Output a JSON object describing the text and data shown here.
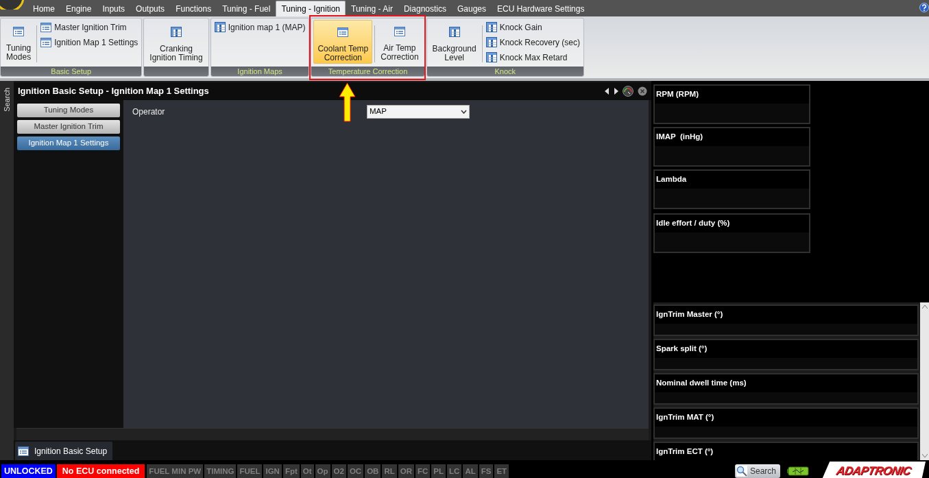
{
  "top_tabs": [
    {
      "label": "Home",
      "selected": false
    },
    {
      "label": "Engine",
      "selected": false
    },
    {
      "label": "Inputs",
      "selected": false
    },
    {
      "label": "Outputs",
      "selected": false
    },
    {
      "label": "Functions",
      "selected": false
    },
    {
      "label": "Tuning - Fuel",
      "selected": false
    },
    {
      "label": "Tuning - Ignition",
      "selected": true
    },
    {
      "label": "Tuning - Air",
      "selected": false
    },
    {
      "label": "Diagnostics",
      "selected": false
    },
    {
      "label": "Gauges",
      "selected": false
    },
    {
      "label": "ECU Hardware Settings",
      "selected": false
    }
  ],
  "ribbon_groups": [
    {
      "title": "Basic Setup",
      "highlighted": false,
      "items": [
        {
          "label": "Tuning\nModes",
          "kind": "large_page",
          "selected": false
        },
        {
          "label": "Master Ignition Trim",
          "kind": "small_page",
          "selected": false
        },
        {
          "label": "Ignition Map 1 Settings",
          "kind": "small_page",
          "selected": false
        }
      ]
    },
    {
      "highlighted": false,
      "items": [
        {
          "label": "Cranking\nIgnition Timing",
          "kind": "large_table",
          "selected": false
        }
      ]
    },
    {
      "title": "Ignition Maps",
      "highlighted": false,
      "items": [
        {
          "label": "Ignition map 1 (MAP)",
          "kind": "small_table",
          "selected": false
        }
      ]
    },
    {
      "title": "Temperature Correction",
      "highlighted": true,
      "items": [
        {
          "label": "Coolant Temp\nCorrection",
          "kind": "large_page",
          "selected": true
        },
        {
          "label": "Air Temp\nCorrection",
          "kind": "large_page",
          "selected": false
        }
      ]
    },
    {
      "title": "Knock",
      "highlighted": false,
      "items": [
        {
          "label": "Background\nLevel",
          "kind": "large_table",
          "selected": false
        },
        {
          "label": "Knock Gain",
          "kind": "small_table",
          "selected": false
        },
        {
          "label": "Knock Recovery (sec)",
          "kind": "small_table",
          "selected": false
        },
        {
          "label": "Knock Max Retard",
          "kind": "small_table",
          "selected": false
        }
      ]
    }
  ],
  "side_tab": "Search",
  "panel": {
    "title": "Ignition Basic Setup - Ignition Map 1 Settings",
    "nav": [
      {
        "label": "Tuning Modes",
        "selected": false
      },
      {
        "label": "Master Ignition Trim",
        "selected": false
      },
      {
        "label": "Ignition Map 1 Settings",
        "selected": true
      }
    ],
    "fields": [
      {
        "label": "Operator",
        "value": "MAP"
      }
    ]
  },
  "bottom_tabs": [
    {
      "label": "Ignition Basic Setup",
      "selected": true
    }
  ],
  "gauges_top": [
    "RPM (RPM)",
    "IMAP  (inHg)",
    "Lambda",
    "Idle effort / duty (%)"
  ],
  "gauges_list": [
    "IgnTrim Master (°)",
    "Spark split (°)",
    "Nominal dwell time (ms)",
    "IgnTrim MAT (°)",
    "IgnTrim ECT (°)"
  ],
  "status_bar": {
    "lock": "UNLOCKED",
    "connection": "No ECU connected",
    "indicators": [
      "FUEL MIN PW",
      "TIMING",
      "FUEL",
      "IGN",
      "Fpt",
      "Ot",
      "Op",
      "O2",
      "OC",
      "OB",
      "RL",
      "OR",
      "FC",
      "PL",
      "LC",
      "AL",
      "FS",
      "ET"
    ],
    "search": "Search",
    "logo": "ADAPTRONIC"
  }
}
